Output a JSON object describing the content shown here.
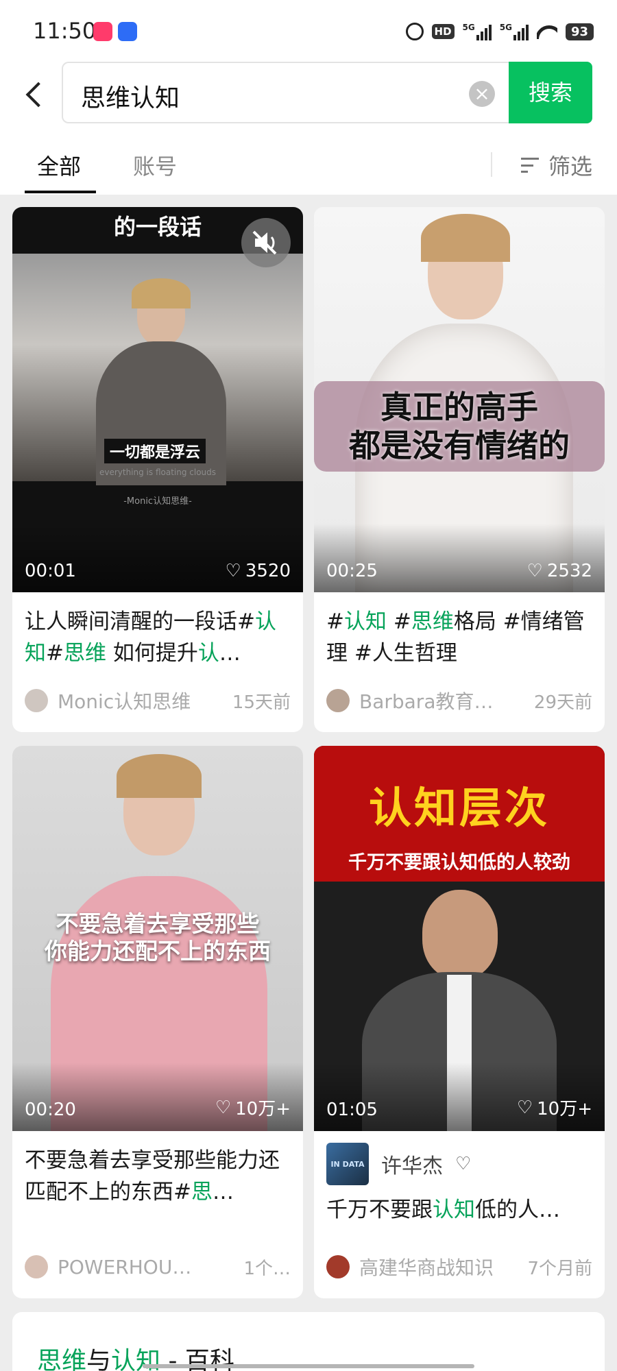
{
  "status_bar": {
    "time": "11:50",
    "hd": "HD",
    "net1": "5G",
    "net2": "5G",
    "battery": "93"
  },
  "search": {
    "query": "思维认知",
    "button_label": "搜索"
  },
  "tabs": {
    "items": [
      "全部",
      "账号"
    ],
    "active": "全部",
    "filter_label": "筛选"
  },
  "colors": {
    "accent_green": "#07c160",
    "highlight_green": "#07a35a"
  },
  "results": [
    {
      "overlay_top": "的一段话",
      "overlay_caption": "一切都是浮云",
      "overlay_subcaption": "everything is floating clouds",
      "overlay_watermark": "-Monic认知思维-",
      "duration": "00:01",
      "likes": "3520",
      "desc_parts": [
        "让人瞬间清醒的一段话#",
        "认知",
        "#",
        "思维",
        " 如何提升",
        "认",
        "…"
      ],
      "author": "Monic认知思维",
      "time": "15天前"
    },
    {
      "overlay_caption_line1": "真正的高手",
      "overlay_caption_line2": "都是没有情绪的",
      "duration": "00:25",
      "likes": "2532",
      "desc_parts": [
        "#",
        "认知",
        " #",
        "思维",
        "格局 #情绪管理 #人生哲理"
      ],
      "author": "Barbara教育…",
      "time": "29天前"
    },
    {
      "overlay_caption_line1": "不要急着去享受那些",
      "overlay_caption_line2": "你能力还配不上的东西",
      "duration": "00:20",
      "likes": "10万+",
      "desc_parts": [
        "不要急着去享受那些能力还匹配不上的东西#",
        "思",
        "…"
      ],
      "author": "POWERHOU…",
      "time": "1个…"
    },
    {
      "overlay_title": "认知层次",
      "overlay_subtitle": "千万不要跟认知低的人较劲",
      "duration": "01:05",
      "likes": "10万+",
      "account_logo": "IN DATA",
      "account_name": "许华杰",
      "desc_parts": [
        "千万不要跟",
        "认知",
        "低的人…"
      ],
      "author": "高建华商战知识",
      "time": "7个月前"
    }
  ],
  "wiki": {
    "parts": [
      "思维",
      "与",
      "认知",
      " - 百科"
    ]
  }
}
